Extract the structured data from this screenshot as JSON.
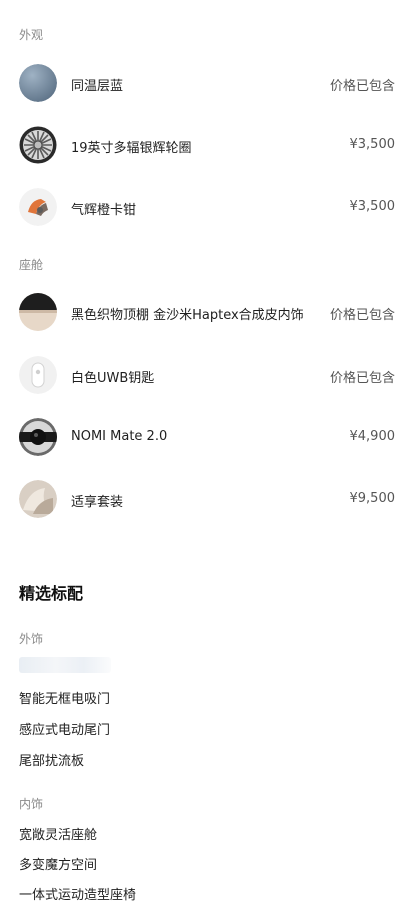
{
  "exterior": {
    "label": "外观",
    "items": [
      {
        "name": "同温层蓝",
        "price": "价格已包含",
        "icon": "paint-swatch-icon",
        "color": "#7e93a8"
      },
      {
        "name": "19英寸多辐银辉轮圈",
        "price": "¥3,500",
        "icon": "wheel-icon"
      },
      {
        "name": "气辉橙卡钳",
        "price": "¥3,500",
        "icon": "brake-caliper-icon",
        "color": "#e0753a"
      }
    ]
  },
  "cabin": {
    "label": "座舱",
    "items": [
      {
        "name": "黑色织物顶棚 金沙米Haptex合成皮内饰",
        "price": "价格已包含",
        "icon": "interior-swatch-icon"
      },
      {
        "name": "白色UWB钥匙",
        "price": "价格已包含",
        "icon": "key-icon"
      },
      {
        "name": "NOMI Mate 2.0",
        "price": "¥4,900",
        "icon": "nomi-icon"
      },
      {
        "name": "适享套装",
        "price": "¥9,500",
        "icon": "package-icon"
      }
    ]
  },
  "standard": {
    "title": "精选标配",
    "exterior_label": "外饰",
    "exterior_items": [
      "智能无框电吸门",
      "感应式电动尾门",
      "尾部扰流板"
    ],
    "interior_label": "内饰",
    "interior_items": [
      "宽敞灵活座舱",
      "多变魔方空间",
      "一体式运动造型座椅"
    ]
  }
}
